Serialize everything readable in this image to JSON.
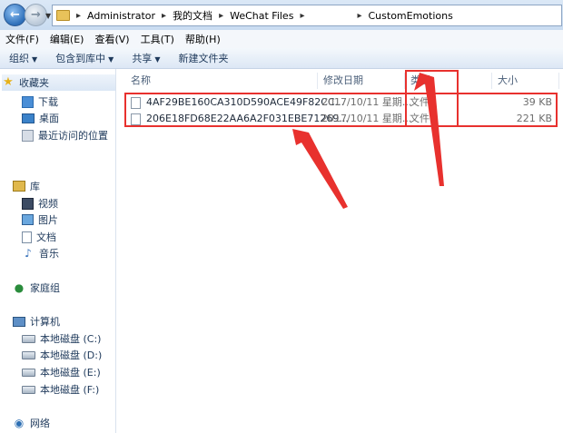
{
  "address_bar": {
    "breadcrumbs": [
      "Administrator",
      "我的文档",
      "WeChat Files",
      "",
      "CustomEmotions"
    ]
  },
  "menu": [
    "文件(F)",
    "编辑(E)",
    "查看(V)",
    "工具(T)",
    "帮助(H)"
  ],
  "toolbar": {
    "organize": "组织",
    "include_library": "包含到库中",
    "share": "共享",
    "new_folder": "新建文件夹"
  },
  "sidebar": {
    "favorites": {
      "label": "收藏夹",
      "items": [
        "下载",
        "桌面",
        "最近访问的位置"
      ]
    },
    "libraries": {
      "label": "库",
      "items": [
        "视频",
        "图片",
        "文档",
        "音乐"
      ]
    },
    "homegroup": "家庭组",
    "computer": {
      "label": "计算机",
      "items": [
        "本地磁盘 (C:)",
        "本地磁盘 (D:)",
        "本地磁盘 (E:)",
        "本地磁盘 (F:)"
      ]
    },
    "network": "网络"
  },
  "columns": {
    "name": "名称",
    "date": "修改日期",
    "type": "类型",
    "size": "大小"
  },
  "files": [
    {
      "name": "4AF29BE160CA310D590ACE49F82CC...",
      "date": "2017/10/11 星期...",
      "type": "文件",
      "size": "39 KB"
    },
    {
      "name": "206E18FD68E22AA6A2F031EBE71269...",
      "date": "2017/10/11 星期...",
      "type": "文件",
      "size": "221 KB"
    }
  ],
  "colors": {
    "highlight": "#e8312e",
    "accent": "#1e395b"
  }
}
